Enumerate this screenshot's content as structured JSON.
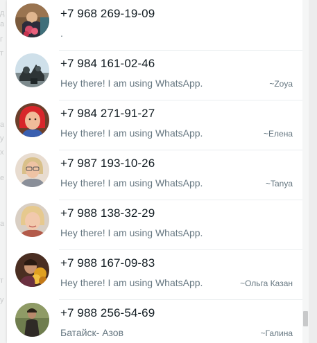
{
  "contacts": [
    {
      "phone": "+7 968 269-19-09",
      "status": ".",
      "pushname": ""
    },
    {
      "phone": "+7 984 161-02-46",
      "status": "Hey there! I am using WhatsApp.",
      "pushname": "~Zoya"
    },
    {
      "phone": "+7 984 271-91-27",
      "status": "Hey there! I am using WhatsApp.",
      "pushname": "~Елена"
    },
    {
      "phone": "+7 987 193-10-26",
      "status": "Hey there! I am using WhatsApp.",
      "pushname": "~Tanya"
    },
    {
      "phone": "+7 988 138-32-29",
      "status": "Hey there! I am using WhatsApp.",
      "pushname": ""
    },
    {
      "phone": "+7 988 167-09-83",
      "status": "Hey there! I am using WhatsApp.",
      "pushname": "~Ольга Казан"
    },
    {
      "phone": "+7 988 256-54-69",
      "status": "Батайск- Азов",
      "pushname": "~Галина"
    }
  ],
  "colors": {
    "primary_text": "#111b21",
    "secondary_text": "#667781",
    "divider": "#e9edef",
    "panel_bg": "#ffffff"
  }
}
